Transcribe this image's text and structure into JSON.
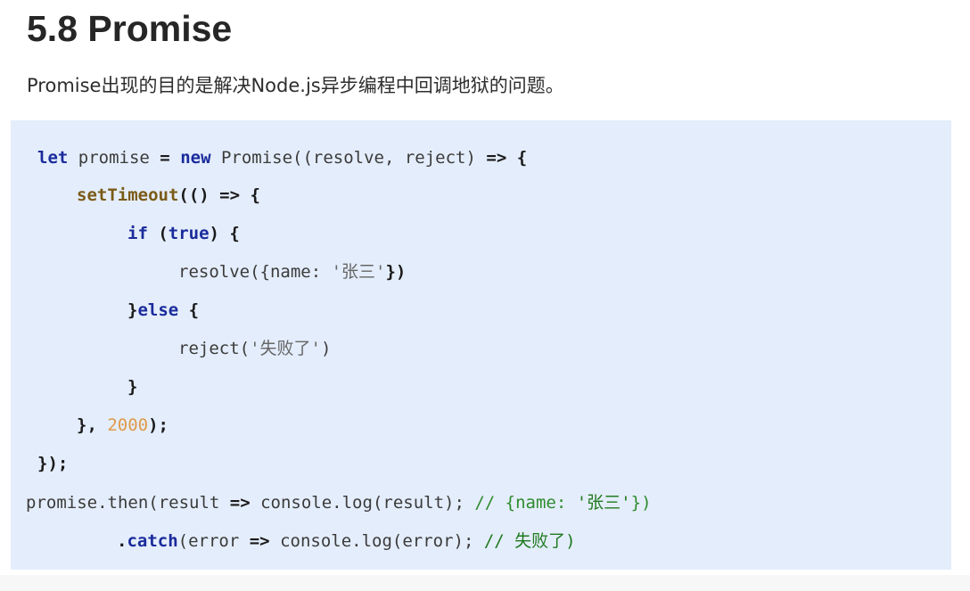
{
  "heading": "5.8 Promise",
  "description": "Promise出现的目的是解决Node.js异步编程中回调地狱的问题。",
  "code": {
    "l1": {
      "a": "let",
      "b": " promise ",
      "c": "=",
      "d": " ",
      "e": "new",
      "f": " Promise((resolve, reject) ",
      "g": "=>",
      "h": " {"
    },
    "l2": {
      "a": "setTimeout",
      "b": "(() ",
      "c": "=>",
      "d": " {"
    },
    "l3": {
      "a": "if",
      "b": " (",
      "c": "true",
      "d": ") {"
    },
    "l4": {
      "a": "resolve({name: ",
      "b": "'张三'",
      "c": "})"
    },
    "l5": {
      "a": "}",
      "b": "else",
      "c": " {"
    },
    "l6": {
      "a": "reject(",
      "b": "'失败了'",
      "c": ")"
    },
    "l7": {
      "a": "}"
    },
    "l8": {
      "a": "}, ",
      "b": "2000",
      "c": ");"
    },
    "l9": {
      "a": "});"
    },
    "l10": {
      "a": "promise.then(result ",
      "b": "=>",
      "c": " console.log(result); ",
      "d": "// {name: ",
      "e": "'张三'",
      "f": "})"
    },
    "l11": {
      "a": ".",
      "b": "catch",
      "c": "(error ",
      "d": "=>",
      "e": " console.log(error); ",
      "f": "// 失败了)"
    }
  }
}
